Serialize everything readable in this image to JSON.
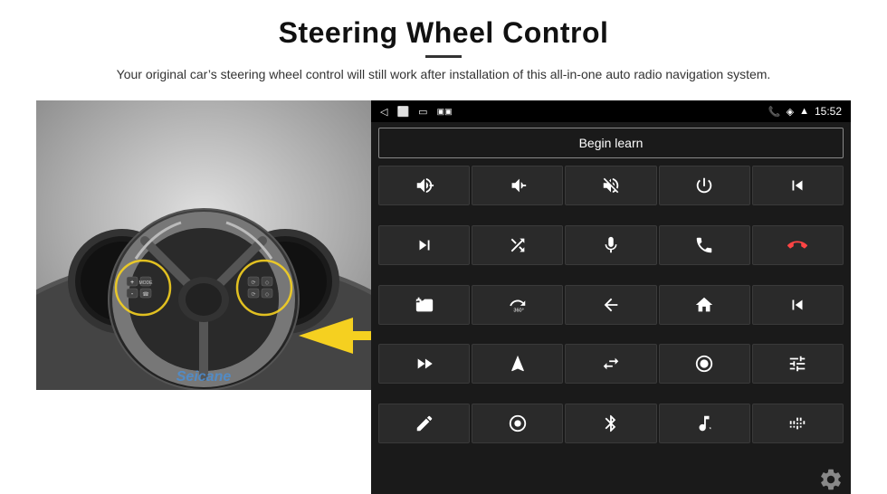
{
  "title": "Steering Wheel Control",
  "subtitle": "Your original car’s steering wheel control will still work after installation of this all-in-one auto radio navigation system.",
  "divider": true,
  "android": {
    "status_time": "15:52",
    "begin_learn_label": "Begin learn",
    "controls": [
      {
        "icon": "vol-up",
        "symbol": "🔊+"
      },
      {
        "icon": "vol-down",
        "symbol": "🔉-"
      },
      {
        "icon": "vol-mute",
        "symbol": "🔇"
      },
      {
        "icon": "power",
        "symbol": "⏻"
      },
      {
        "icon": "prev-track",
        "symbol": "⏮"
      },
      {
        "icon": "next-track",
        "symbol": "⏭"
      },
      {
        "icon": "shuffle",
        "symbol": "⇄"
      },
      {
        "icon": "mic",
        "symbol": "🎤"
      },
      {
        "icon": "phone",
        "symbol": "📞"
      },
      {
        "icon": "hang-up",
        "symbol": "📵"
      },
      {
        "icon": "camera",
        "symbol": "📷"
      },
      {
        "icon": "360",
        "symbol": "360"
      },
      {
        "icon": "back",
        "symbol": "↩"
      },
      {
        "icon": "home",
        "symbol": "🏠"
      },
      {
        "icon": "skip-back",
        "symbol": "⏮"
      },
      {
        "icon": "fast-forward",
        "symbol": "⏭"
      },
      {
        "icon": "navigate",
        "symbol": "➤"
      },
      {
        "icon": "swap",
        "symbol": "⇄"
      },
      {
        "icon": "record",
        "symbol": "⏺"
      },
      {
        "icon": "equalizer",
        "symbol": "⚙"
      },
      {
        "icon": "pen",
        "symbol": "✏"
      },
      {
        "icon": "power2",
        "symbol": "⏻"
      },
      {
        "icon": "bluetooth",
        "symbol": "Ⓑ"
      },
      {
        "icon": "music",
        "symbol": "🎵"
      },
      {
        "icon": "wave",
        "symbol": "≋"
      }
    ]
  },
  "watermark": "Seicane",
  "gear_label": "settings"
}
